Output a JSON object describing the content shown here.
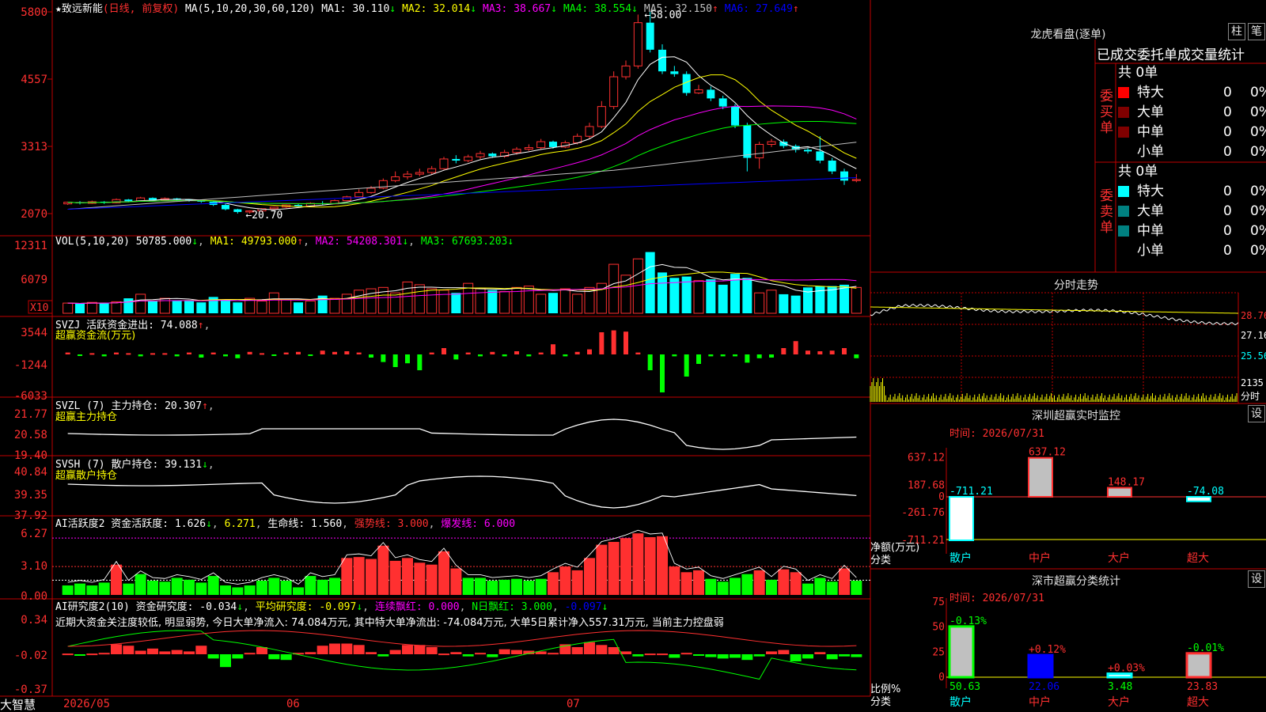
{
  "stock": {
    "name": "致远新能",
    "mode": "(日线, 前复权)",
    "ma_label": "MA(5,10,20,30,60,120)",
    "ma_values": [
      {
        "name": "MA1:",
        "value": "30.110",
        "color": "#ffffff",
        "arrow": "↓"
      },
      {
        "name": "MA2:",
        "value": "32.014",
        "color": "#ffff00",
        "arrow": "↓"
      },
      {
        "name": "MA3:",
        "value": "38.667",
        "color": "#ff00ff",
        "arrow": "↓"
      },
      {
        "name": "MA4:",
        "value": "38.554",
        "color": "#00ff00",
        "arrow": "↓"
      },
      {
        "name": "MA5:",
        "value": "32.150",
        "color": "#c0c0c0",
        "arrow": "↑"
      },
      {
        "name": "MA6:",
        "value": "27.649",
        "color": "#0000ff",
        "arrow": "↑"
      }
    ],
    "high_label": "58.00",
    "low_label": "20.70"
  },
  "price_axis": [
    "5800",
    "4557",
    "3313",
    "2070"
  ],
  "vol": {
    "label": "VOL(5,10,20)",
    "value": "50785.000",
    "ma1": "MA1: 49793.000",
    "ma2": "MA2: 54208.301",
    "ma3": "MA3: 67693.203",
    "axis": [
      "12311",
      "6079"
    ],
    "unit": "X10"
  },
  "svzj": {
    "label": "SVZJ  活跃资金进出: 74.088",
    "sub": "超赢资金流(万元)",
    "axis": [
      "3544",
      "-1244",
      "-6033"
    ]
  },
  "svzl": {
    "label": "SVZL (7) 主力持仓: 20.307",
    "sub": "超赢主力持仓",
    "axis": [
      "21.77",
      "20.58",
      "19.40"
    ]
  },
  "svsh": {
    "label": "SVSH (7) 散户持仓: 39.131",
    "sub": "超赢散户持仓",
    "axis": [
      "40.84",
      "39.35",
      "37.92"
    ]
  },
  "ai1": {
    "label": "AI活跃度2 资金活跃度: 1.626",
    "v2": "6.271",
    "life": "生命线: 1.560",
    "strong": "强势线: 3.000",
    "burst": "爆发线: 6.000",
    "axis": [
      "6.27",
      "3.10",
      "0.00"
    ]
  },
  "ai2": {
    "label": "AI研究度2(10) 资金研究度: -0.034",
    "avg": "平均研究度: -0.097",
    "red": "连续飘红: 0.000",
    "nred": "N日飘红: 3.000",
    "neg": "-0.097",
    "comment": "近期大资金关注度较低, 明显弱势, 今日大单净流入: 74.084万元, 其中特大单净流出: -74.084万元, 大单5日累计净入557.31万元, 当前主力控盘弱",
    "axis": [
      "0.34",
      "-0.02",
      "-0.37"
    ]
  },
  "bottom": {
    "logo": "大智慧",
    "dates": [
      "2026/05",
      "06",
      "07"
    ]
  },
  "right": {
    "longhu_title": "龙虎看盘(逐单)",
    "btn1": "柱",
    "btn2": "笔",
    "tabs": "已成交委托单成交量统计",
    "buy_side": "委买单",
    "sell_side": "委卖单",
    "buy_total": "共 0单",
    "sell_total": "共 0单",
    "rows": [
      {
        "label": "特大",
        "count": "0",
        "pct": "0%"
      },
      {
        "label": "大单",
        "count": "0",
        "pct": "0%"
      },
      {
        "label": "中单",
        "count": "0",
        "pct": "0%"
      },
      {
        "label": "小单",
        "count": "0",
        "pct": "0%"
      }
    ],
    "fenshi_title": "分时走势",
    "fenshi_axis": [
      "28.76",
      "27.16",
      "25.56",
      "2135"
    ],
    "fenshi_unit": "分时",
    "monitor_title": "深圳超赢实时监控",
    "monitor_btn": "设",
    "monitor_time": "时间: 2026/07/31",
    "monitor_axis": [
      "637.12",
      "187.68",
      "0",
      "-261.76",
      "-711.21"
    ],
    "monitor_side": [
      "净额(万元)",
      "分类"
    ],
    "monitor_bars": [
      {
        "cat": "散户",
        "value": -711.21,
        "label": "-711.21"
      },
      {
        "cat": "中户",
        "value": 637.12,
        "label": "637.12"
      },
      {
        "cat": "大户",
        "value": 148.17,
        "label": "148.17"
      },
      {
        "cat": "超大",
        "value": -74.08,
        "label": "-74.08"
      }
    ],
    "class_title": "深市超赢分类统计",
    "class_btn": "设",
    "class_time": "时间: 2026/07/31",
    "class_axis": [
      "75",
      "50",
      "25",
      "0"
    ],
    "class_side": [
      "比例%",
      "分类"
    ],
    "class_bars": [
      {
        "cat": "散户",
        "value": 50.63,
        "label": "50.63",
        "chg": "-0.13%"
      },
      {
        "cat": "中户",
        "value": 22.06,
        "label": "22.06",
        "chg": "+0.12%"
      },
      {
        "cat": "大户",
        "value": 3.48,
        "label": "3.48",
        "chg": "+0.03%"
      },
      {
        "cat": "超大",
        "value": 23.83,
        "label": "23.83",
        "chg": "-0.01%"
      }
    ]
  },
  "colors": {
    "up": "#ff3030",
    "down": "#00ffff",
    "grid": "#c00000",
    "axis_text": "#ff3030"
  },
  "chart_data": {
    "type": "candlestick",
    "candles": [
      [
        22.5,
        22.8,
        22.3,
        22.9
      ],
      [
        22.8,
        22.6,
        22.4,
        23.0
      ],
      [
        22.6,
        22.9,
        22.5,
        23.1
      ],
      [
        22.9,
        22.7,
        22.5,
        23.0
      ],
      [
        22.7,
        23.3,
        22.6,
        23.5
      ],
      [
        23.3,
        23.0,
        22.8,
        23.4
      ],
      [
        23.0,
        23.6,
        22.9,
        23.8
      ],
      [
        23.6,
        23.2,
        23.0,
        23.7
      ],
      [
        23.2,
        23.5,
        23.1,
        23.7
      ],
      [
        23.5,
        23.3,
        23.0,
        23.6
      ],
      [
        23.3,
        23.1,
        22.9,
        23.4
      ],
      [
        23.1,
        22.9,
        22.7,
        23.2
      ],
      [
        22.9,
        22.3,
        22.1,
        23.0
      ],
      [
        22.3,
        21.5,
        21.3,
        22.5
      ],
      [
        21.5,
        21.0,
        20.7,
        21.6
      ],
      [
        21.0,
        21.2,
        20.7,
        21.3
      ],
      [
        21.2,
        21.6,
        21.0,
        21.7
      ],
      [
        21.6,
        21.9,
        21.4,
        22.0
      ],
      [
        21.9,
        22.3,
        21.7,
        22.4
      ],
      [
        22.3,
        22.1,
        21.9,
        22.5
      ],
      [
        22.1,
        22.6,
        22.0,
        22.8
      ],
      [
        22.6,
        22.5,
        22.3,
        23.0
      ],
      [
        22.5,
        23.1,
        22.4,
        23.3
      ],
      [
        23.1,
        23.8,
        23.0,
        24.0
      ],
      [
        23.8,
        24.6,
        23.6,
        25.2
      ],
      [
        24.6,
        25.4,
        24.4,
        25.8
      ],
      [
        25.4,
        26.8,
        25.2,
        27.2
      ],
      [
        26.8,
        27.5,
        26.5,
        28.5
      ],
      [
        27.5,
        28.0,
        27.0,
        28.6
      ],
      [
        28.0,
        28.3,
        27.6,
        29.0
      ],
      [
        28.3,
        29.0,
        28.0,
        29.5
      ],
      [
        29.0,
        30.8,
        28.8,
        31.2
      ],
      [
        30.8,
        30.5,
        30.0,
        31.5
      ],
      [
        30.5,
        31.2,
        30.2,
        31.6
      ],
      [
        31.2,
        31.8,
        30.8,
        32.3
      ],
      [
        31.8,
        31.3,
        31.0,
        32.0
      ],
      [
        31.3,
        32.0,
        31.0,
        32.5
      ],
      [
        32.0,
        32.6,
        31.6,
        33.0
      ],
      [
        32.6,
        32.9,
        32.3,
        33.5
      ],
      [
        32.9,
        34.0,
        32.6,
        34.5
      ],
      [
        34.0,
        33.0,
        32.7,
        34.2
      ],
      [
        33.0,
        33.8,
        32.8,
        34.2
      ],
      [
        33.8,
        35.0,
        33.5,
        35.5
      ],
      [
        35.0,
        36.8,
        34.6,
        37.5
      ],
      [
        36.8,
        40.5,
        36.5,
        41.5
      ],
      [
        40.5,
        46.0,
        40.0,
        47.0
      ],
      [
        46.0,
        48.0,
        45.5,
        49.0
      ],
      [
        48.0,
        56.0,
        47.5,
        57.5
      ],
      [
        56.0,
        51.0,
        50.5,
        58.0
      ],
      [
        51.0,
        47.0,
        46.5,
        52.0
      ],
      [
        47.0,
        46.5,
        46.0,
        48.0
      ],
      [
        46.5,
        43.0,
        42.5,
        47.0
      ],
      [
        43.0,
        43.6,
        42.8,
        44.5
      ],
      [
        43.6,
        42.0,
        41.5,
        44.2
      ],
      [
        42.0,
        40.5,
        40.0,
        42.5
      ],
      [
        40.5,
        37.0,
        36.5,
        41.0
      ],
      [
        37.0,
        31.0,
        28.5,
        37.5
      ],
      [
        31.0,
        33.5,
        29.0,
        34.0
      ],
      [
        33.5,
        34.0,
        33.0,
        34.5
      ],
      [
        34.0,
        33.2,
        32.8,
        34.4
      ],
      [
        33.2,
        32.5,
        32.0,
        33.5
      ],
      [
        32.5,
        32.2,
        31.8,
        32.8
      ],
      [
        32.2,
        30.5,
        30.0,
        35.0
      ],
      [
        30.5,
        28.5,
        28.0,
        31.0
      ],
      [
        28.5,
        26.8,
        26.0,
        29.0
      ],
      [
        26.8,
        27.0,
        26.5,
        28.0
      ]
    ],
    "ma_series_names": [
      "MA1",
      "MA2",
      "MA3",
      "MA4",
      "MA5",
      "MA6"
    ],
    "ylim": [
      20.7,
      58.0
    ]
  }
}
